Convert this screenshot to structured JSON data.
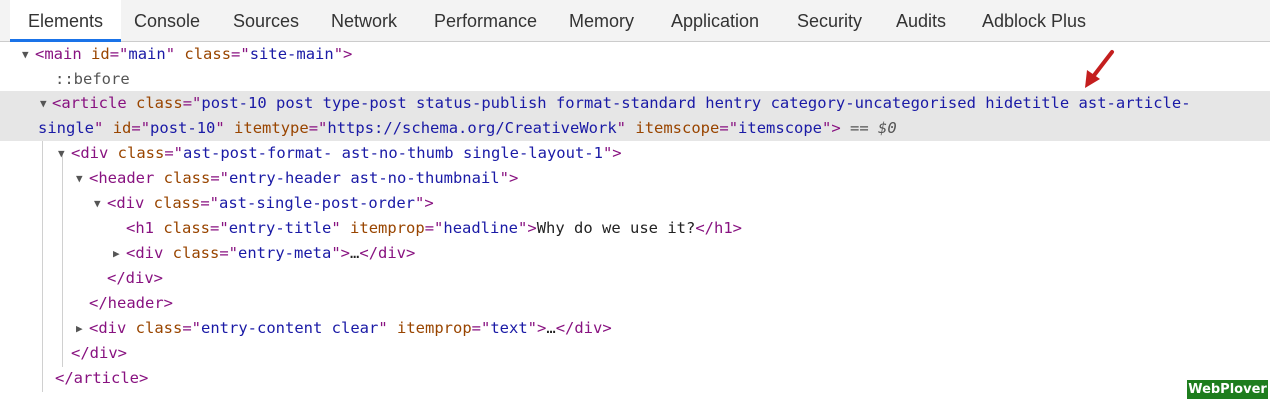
{
  "tabs": [
    {
      "label": "Elements",
      "active": true
    },
    {
      "label": "Console"
    },
    {
      "label": "Sources"
    },
    {
      "label": "Network"
    },
    {
      "label": "Performance"
    },
    {
      "label": "Memory"
    },
    {
      "label": "Application"
    },
    {
      "label": "Security"
    },
    {
      "label": "Audits"
    },
    {
      "label": "Adblock Plus"
    }
  ],
  "dom": {
    "main_tag": "main",
    "main_id": "main",
    "main_class": "site-main",
    "before": "::before",
    "article_tag": "article",
    "article_class_part1": "post-10 post type-post status-publish format-standard hentry category-uncategorised hidetitle ast-article-",
    "article_class_part2": "single",
    "article_id": "post-10",
    "article_itemtype": "https://schema.org/CreativeWork",
    "article_itemscope": "itemscope",
    "selected_marker": "== $0",
    "div_class": "ast-post-format- ast-no-thumb single-layout-1",
    "header_class": "entry-header ast-no-thumbnail",
    "order_class": "ast-single-post-order",
    "h1_class": "entry-title",
    "h1_itemprop": "headline",
    "h1_text": "Why do we use it?",
    "meta_class": "entry-meta",
    "ellipsis": "…",
    "content_class": "entry-content clear",
    "content_itemprop": "text"
  },
  "watermark": "WebPlover",
  "colors": {
    "tag": "#881280",
    "attribute": "#994500",
    "value": "#1a1aa6",
    "selection_bg": "#e6e6e6",
    "arrow": "#c41e1e",
    "watermark_bg": "#1e7d1e"
  }
}
